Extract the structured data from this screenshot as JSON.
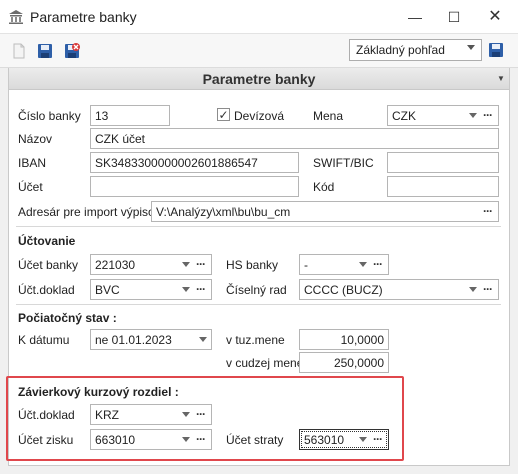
{
  "window": {
    "title": "Parametre banky"
  },
  "toolbar": {
    "view_select": "Základný pohľad"
  },
  "panel": {
    "header": "Parametre banky"
  },
  "bank": {
    "cislo_banky_label": "Číslo banky",
    "cislo_banky": "13",
    "devizova_label": "Devízová",
    "devizova_checked": true,
    "mena_label": "Mena",
    "mena": "CZK",
    "nazov_label": "Názov",
    "nazov": "CZK účet",
    "iban_label": "IBAN",
    "iban": "SK3483300000002601886547",
    "swift_label": "SWIFT/BIC",
    "swift": "",
    "ucet_label": "Účet",
    "ucet": "",
    "kod_label": "Kód",
    "kod": "",
    "adresar_label": "Adresár pre import výpisov",
    "adresar": "V:\\Analýzy\\xml\\bu\\bu_cm"
  },
  "uctovanie": {
    "section_label": "Účtovanie",
    "ucet_banky_label": "Účet banky",
    "ucet_banky": "221030",
    "hs_banky_label": "HS banky",
    "hs_banky": "-",
    "uct_doklad_label": "Účt.doklad",
    "uct_doklad": "BVC",
    "ciselny_rad_label": "Číselný rad",
    "ciselny_rad": "CCCC (BUCZ)"
  },
  "pociatocny": {
    "section_label": "Počiatočný stav :",
    "k_datumu_label": "K dátumu",
    "k_datumu": "ne 01.01.2023",
    "v_tuz_mene_label": "v tuz.mene",
    "v_tuz_mene": "10,0000",
    "v_cudzej_mene_label": "v cudzej mene",
    "v_cudzej_mene": "250,0000"
  },
  "zavierkovy": {
    "section_label": "Závierkový kurzový rozdiel :",
    "uct_doklad_label": "Účt.doklad",
    "uct_doklad": "KRZ",
    "ucet_zisku_label": "Účet zisku",
    "ucet_zisku": "663010",
    "ucet_straty_label": "Účet straty",
    "ucet_straty": "563010"
  },
  "colors": {
    "highlight": "#e0474c"
  }
}
